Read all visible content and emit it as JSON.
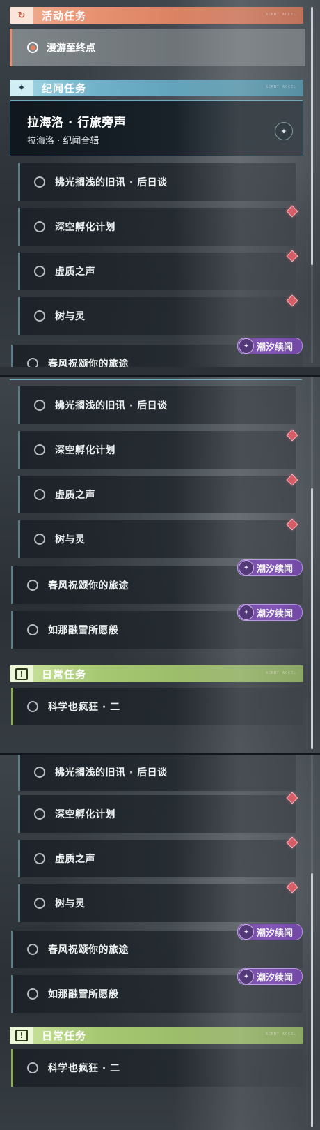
{
  "sections": {
    "activity": {
      "title": "活动任务",
      "icon": "activity-refresh-icon",
      "deco": "RCRNT ACCEL"
    },
    "chronicle": {
      "title": "纪闻任务",
      "icon": "star-compass-icon",
      "deco": "RCRNT ACCEL"
    },
    "daily": {
      "title": "日常任务",
      "icon": "exclamation-icon",
      "deco": "RCRNT ACCEL"
    }
  },
  "active_quest": {
    "label": "漫游至终点"
  },
  "chronicle_card": {
    "title": "拉海洛 · 行旅旁声",
    "subtitle": "拉海洛 · 纪闻合辑"
  },
  "quests": [
    {
      "label": "拂光搁浅的旧讯 · 后日谈"
    },
    {
      "label": "深空孵化计划"
    },
    {
      "label": "虚质之声"
    },
    {
      "label": "树与灵"
    },
    {
      "label": "春风祝颂你的旅途"
    },
    {
      "label": "如那融雪所愿般"
    }
  ],
  "daily_quest": {
    "label": "科学也疯狂 · 二"
  },
  "badge_label": "潮汐续闻",
  "colors": {
    "activity": "#e7906f",
    "chronicle": "#6fb1c8",
    "daily": "#a7c873",
    "badge": "#6b3aa6",
    "marker": "#e3505d"
  }
}
